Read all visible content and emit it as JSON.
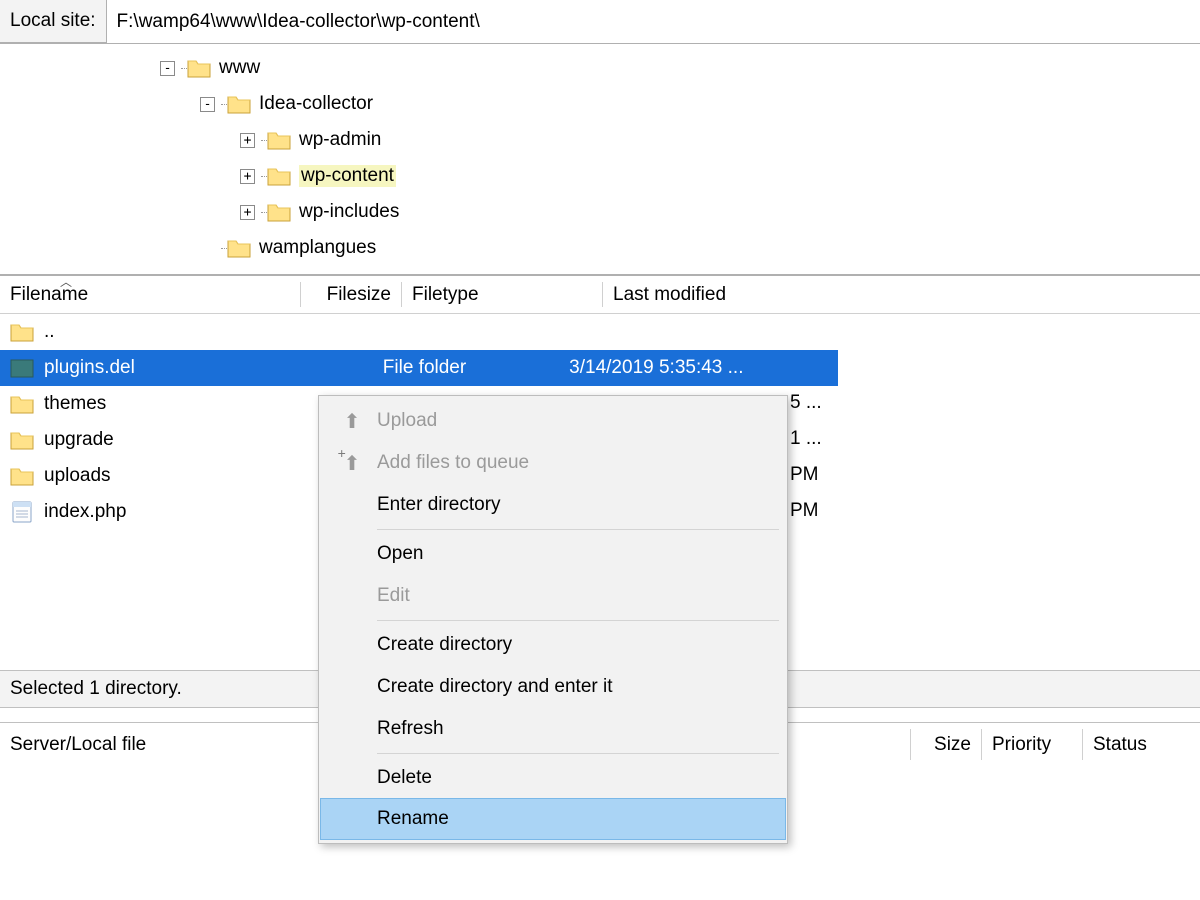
{
  "path_bar": {
    "label": "Local site:",
    "value": "F:\\wamp64\\www\\Idea-collector\\wp-content\\"
  },
  "tree": {
    "nodes": [
      {
        "level": 0,
        "expander": "-",
        "label": "www",
        "selected": false
      },
      {
        "level": 1,
        "expander": "-",
        "label": "Idea-collector",
        "selected": false
      },
      {
        "level": 2,
        "expander": "+",
        "label": "wp-admin",
        "selected": false
      },
      {
        "level": 2,
        "expander": "+",
        "label": "wp-content",
        "selected": true
      },
      {
        "level": 2,
        "expander": "+",
        "label": "wp-includes",
        "selected": false
      },
      {
        "level": 1,
        "expander": "",
        "label": "wamplangues",
        "selected": false
      }
    ]
  },
  "list_header": {
    "filename": "Filename",
    "filesize": "Filesize",
    "filetype": "Filetype",
    "modified": "Last modified"
  },
  "files": [
    {
      "icon": "folder",
      "name": "..",
      "size": "",
      "type": "",
      "modified": "",
      "peek_modified": "",
      "selected": false
    },
    {
      "icon": "folder-sel",
      "name": "plugins.del",
      "size": "",
      "type": "File folder",
      "modified": "3/14/2019 5:35:43 ...",
      "peek_modified": "",
      "selected": true
    },
    {
      "icon": "folder",
      "name": "themes",
      "size": "",
      "type": "",
      "modified": "",
      "peek_modified": "5 ...",
      "selected": false
    },
    {
      "icon": "folder",
      "name": "upgrade",
      "size": "",
      "type": "",
      "modified": "",
      "peek_modified": "1 ...",
      "selected": false
    },
    {
      "icon": "folder",
      "name": "uploads",
      "size": "",
      "type": "",
      "modified": "",
      "peek_modified": "PM",
      "selected": false
    },
    {
      "icon": "file",
      "name": "index.php",
      "size": "",
      "type": "",
      "modified": "",
      "peek_modified": "PM",
      "selected": false
    }
  ],
  "status": {
    "text": "Selected 1 directory."
  },
  "queue_header": {
    "file": "Server/Local file",
    "size": "Size",
    "priority": "Priority",
    "status": "Status"
  },
  "context_menu": {
    "items": [
      {
        "label": "Upload",
        "disabled": true,
        "icon": "upload"
      },
      {
        "label": "Add files to queue",
        "disabled": true,
        "icon": "queue"
      },
      {
        "label": "Enter directory",
        "disabled": false,
        "icon": ""
      },
      {
        "type": "divider"
      },
      {
        "label": "Open",
        "disabled": false,
        "icon": ""
      },
      {
        "label": "Edit",
        "disabled": true,
        "icon": ""
      },
      {
        "type": "divider"
      },
      {
        "label": "Create directory",
        "disabled": false,
        "icon": ""
      },
      {
        "label": "Create directory and enter it",
        "disabled": false,
        "icon": ""
      },
      {
        "label": "Refresh",
        "disabled": false,
        "icon": ""
      },
      {
        "type": "divider"
      },
      {
        "label": "Delete",
        "disabled": false,
        "icon": ""
      },
      {
        "label": "Rename",
        "disabled": false,
        "icon": "",
        "hover": true
      }
    ]
  }
}
